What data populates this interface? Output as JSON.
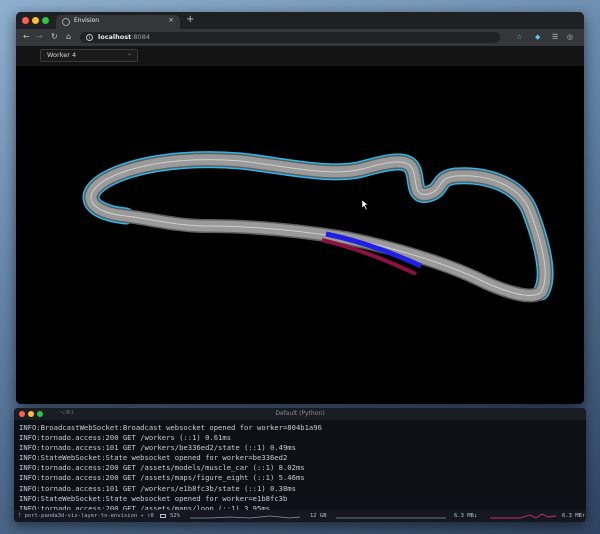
{
  "browser": {
    "tab_title": "Envision",
    "new_tab_label": "+",
    "tab_close_label": "×",
    "url_host": "localhost",
    "url_port": ":8084",
    "nav": {
      "back": "←",
      "forward": "→",
      "reload": "↻",
      "home": "⌂"
    },
    "icons": [
      "star-icon",
      "shield-extension-icon",
      "cast-icon",
      "profile-icon"
    ]
  },
  "app": {
    "worker_select": {
      "value": "Worker 4",
      "caret": "⌄"
    }
  },
  "scene": {
    "colors": {
      "track": "#9a9a9a",
      "track_edge": "#5f5f5f",
      "track_line": "#cfcfcf",
      "route_highlight": "#2cb7e8",
      "vehicle_blue": "#1f1fe6",
      "vehicle_red": "#8c1040"
    }
  },
  "terminal": {
    "shortcut": "⌥⌘1",
    "title": "Default (Python)",
    "log_lines": [
      "INFO:BroadcastWebSocket:Broadcast websocket opened for worker=804b1a96",
      "INFO:tornado.access:200 GET /workers (::1) 0.61ms",
      "INFO:tornado.access:101 GET /workers/be336ed2/state (::1) 0.49ms",
      "INFO:StateWebSocket:State websocket opened for worker=be336ed2",
      "INFO:tornado.access:200 GET /assets/models/muscle_car (::1) 8.02ms",
      "INFO:tornado.access:200 GET /assets/maps/figure_eight (::1) 5.46ms",
      "INFO:tornado.access:101 GET /workers/e1b8fc3b/state (::1) 0.38ms",
      "INFO:StateWebSocket:State websocket opened for worker=e1b8fc3b",
      "INFO:tornado.access:200 GET /assets/maps/loop (::1) 3.95ms"
    ],
    "status": {
      "branch": "ᚠ port-panda3d-viz-layer-to-envision ✦ ↑8",
      "battery": "52%",
      "memory": "12 GB",
      "net_down": "6.3 MB↓",
      "net_up": "6.3 MB↑"
    }
  }
}
